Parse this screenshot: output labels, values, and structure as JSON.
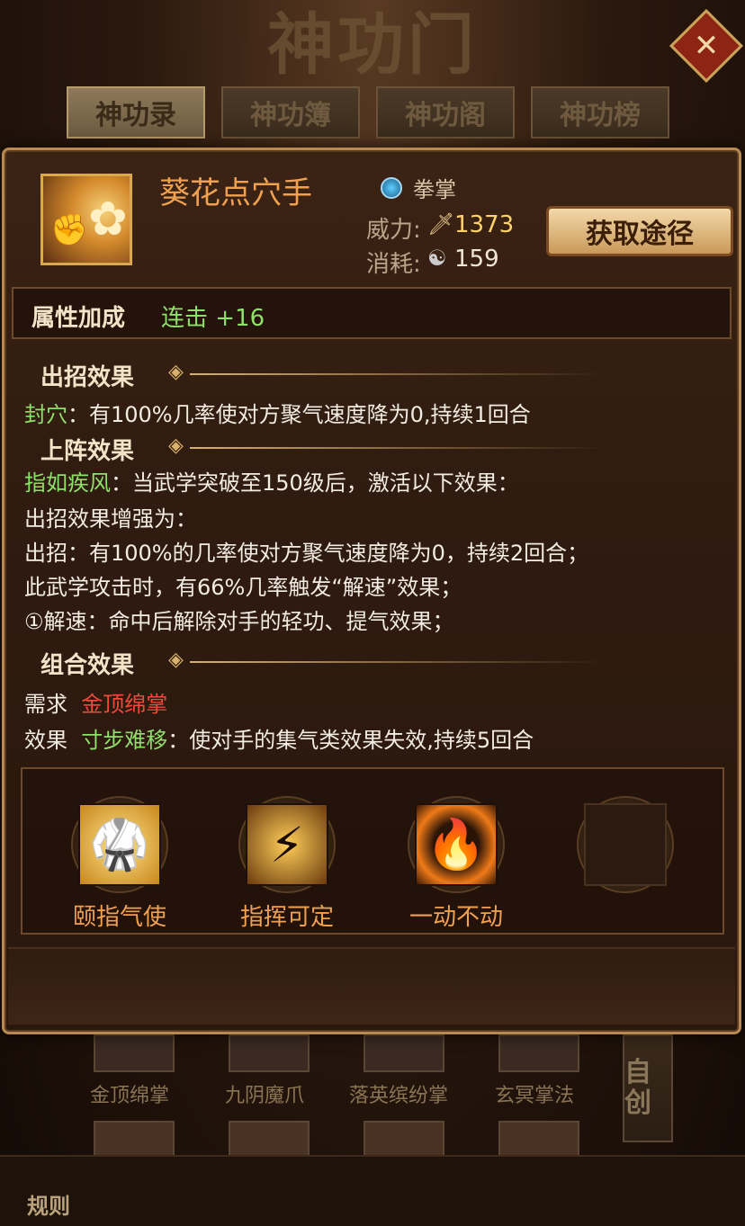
{
  "header": {
    "title": "神功门",
    "close_symbol": "✕",
    "tabs": [
      {
        "label": "神功录",
        "active": true
      },
      {
        "label": "神功簿",
        "active": false
      },
      {
        "label": "神功阁",
        "active": false
      },
      {
        "label": "神功榜",
        "active": false
      }
    ]
  },
  "skill": {
    "name": "葵花点穴手",
    "type": "拳掌",
    "power_label": "威力:",
    "power_value": "1373",
    "cost_label": "消耗:",
    "cost_value": "159",
    "acquire_button": "获取途径",
    "icon": "lotus-fist-icon"
  },
  "attribute": {
    "title": "属性加成",
    "value": "连击 +16"
  },
  "attack_effect": {
    "title": "出招效果",
    "lines": [
      {
        "name": "封穴",
        "text": "：有100%几率使对方聚气速度降为0,持续1回合"
      }
    ]
  },
  "formation_effect": {
    "title": "上阵效果",
    "line1_name": "指如疾风",
    "line1_text": "：当武学突破至150级后，激活以下效果：",
    "line2": "出招效果增强为：",
    "line3": "出招：有100%的几率使对方聚气速度降为0，持续2回合；",
    "line4": "此武学攻击时，有66%几率触发“解速”效果；",
    "line5": "①解速：命中后解除对手的轻功、提气效果；"
  },
  "combo_effect": {
    "title": "组合效果",
    "require_label": "需求",
    "require_value": "金顶绵掌",
    "effect_label": "效果",
    "effect_name": "寸步难移",
    "effect_text": "：使对手的集气类效果失效,持续5回合"
  },
  "combo_slots": [
    {
      "label": "颐指气使",
      "icon": "kick-silhouette-icon"
    },
    {
      "label": "指挥可定",
      "icon": "lightning-warrior-icon"
    },
    {
      "label": "一动不动",
      "icon": "fire-stance-icon"
    },
    {
      "label": "",
      "icon": "empty-slot-icon"
    }
  ],
  "background": {
    "skills": [
      "金顶绵掌",
      "九阴魔爪",
      "落英缤纷掌",
      "玄冥掌法"
    ],
    "side_tab": "自创",
    "rules": "规则"
  },
  "colors": {
    "accent_gold": "#d8b26a",
    "skill_name_orange": "#f0a150",
    "green_text": "#8fe06a",
    "red_text": "#f04a3a"
  }
}
